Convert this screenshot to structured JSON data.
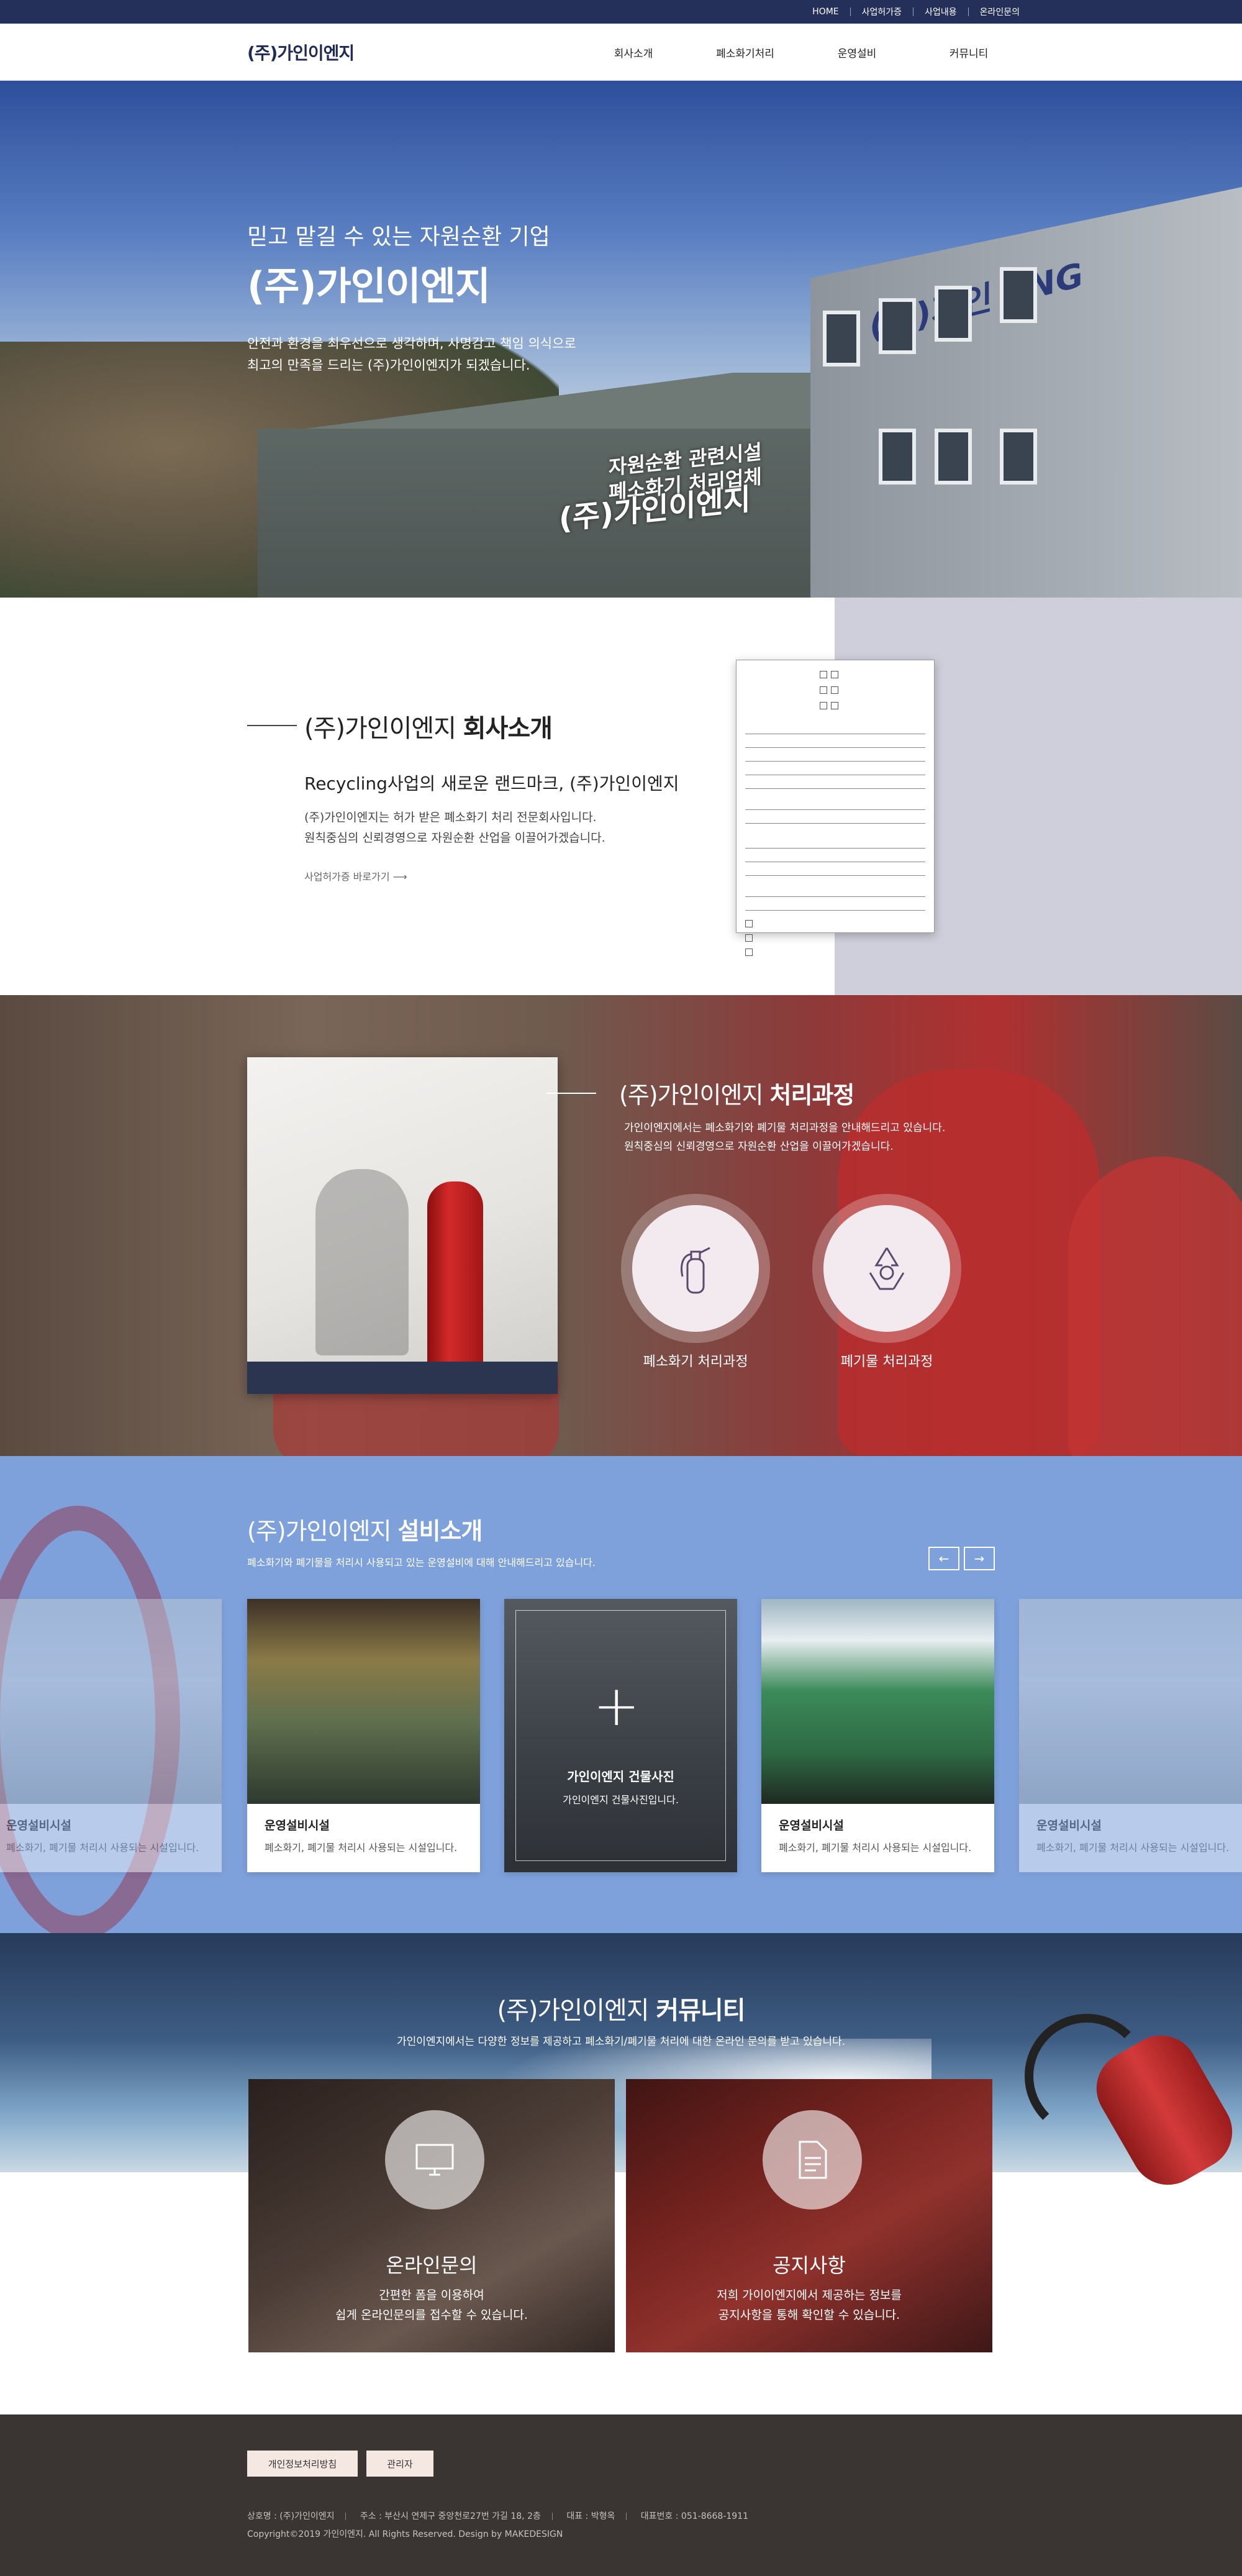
{
  "util_nav": [
    "HOME",
    "사업허가증",
    "사업내용",
    "온라인문의"
  ],
  "logo": "(주)가인이엔지",
  "gnb": [
    "회사소개",
    "폐소화기처리",
    "운영설비",
    "커뮤니티"
  ],
  "hero": {
    "subtitle": "믿고 맡길 수 있는 자원순환 기업",
    "title": "(주)가인이엔지",
    "desc_line1": "안전과 환경을 최우선으로 생각하며, 사명감고 책임 의식으로",
    "desc_line2": "최고의 만족을 드리는 (주)가인이엔지가 되겠습니다.",
    "building_sign_main": "(주)가인이엔지",
    "building_sign_top1": "자원순환 관련시설",
    "building_sign_top2": "폐소화기 처리업체",
    "building_sign_eng": "(주)가인 ENG"
  },
  "about": {
    "title_light": "(주)가인이엔지",
    "title_bold": "회사소개",
    "lead": "Recycling사업의 새로운 랜드마크, (주)가인이엔지",
    "desc_line1": "(주)가인이엔지는 허가 받은 폐소화기 처리 전문회사입니다.",
    "desc_line2": "원칙중심의 신뢰경영으로 자원순환 산업을 이끌어가겠습니다.",
    "more": "사업허가증 바로가기"
  },
  "process": {
    "title_light": "(주)가인이엔지",
    "title_bold": "처리과정",
    "desc_line1": "가인이엔지에서는 폐소화기와 폐기물 처리과정을 안내해드리고 있습니다.",
    "desc_line2": "원칙중심의 신뢰경영으로 자원순환 산업을 이끌어가겠습니다.",
    "items": [
      {
        "label": "폐소화기 처리과정",
        "icon": "fire-extinguisher-icon"
      },
      {
        "label": "폐기물 처리과정",
        "icon": "recycle-icon"
      }
    ]
  },
  "equipment": {
    "title_light": "(주)가인이엔지",
    "title_bold": "설비소개",
    "desc": "폐소화기와 폐기물을 처리시 사용되고 있는 운영설비에 대해 안내해드리고 있습니다.",
    "prev": "←",
    "next": "→",
    "cards": [
      {
        "title": "운영설비시설",
        "desc": "폐소화기, 폐기물 처리시 사용되는 시설입니다."
      },
      {
        "title": "운영설비시설",
        "desc": "폐소화기, 폐기물 처리시 사용되는 시설입니다."
      },
      {
        "title": "가인이엔지 건물사진",
        "desc": "가인이엔지 건물사진입니다."
      },
      {
        "title": "운영설비시설",
        "desc": "폐소화기, 폐기물 처리시 사용되는 시설입니다."
      },
      {
        "title": "운영설비시설",
        "desc": "폐소화기, 폐기물 처리시 사용되는 시설입니다."
      }
    ]
  },
  "community": {
    "title_light": "(주)가인이엔지",
    "title_bold": "커뮤니티",
    "desc": "가인이엔지에서는 다양한 정보를 제공하고 폐소화기/폐기물 처리에 대한 온라인 문의를 받고 있습니다.",
    "boxes": [
      {
        "title": "온라인문의",
        "line1": "간편한 폼을 이용하여",
        "line2": "쉽게 온라인문의를 접수할 수 있습니다.",
        "icon": "monitor-icon"
      },
      {
        "title": "공지사항",
        "line1": "저희 가이이엔지에서 제공하는 정보를",
        "line2": "공지사항을 통해 확인할 수 있습니다.",
        "icon": "document-icon"
      }
    ]
  },
  "footer": {
    "btn_privacy": "개인정보처리방침",
    "btn_admin": "관리자",
    "company": "상호명 : (주)가인이엔지",
    "address": "주소 : 부산시 연제구 중앙천로27번 가길 18, 2층",
    "ceo": "대표 : 박형옥",
    "phone": "대표번호 : 051-8668-1911",
    "copyright": "Copyright©2019 가인이엔지. All Rights Reserved. Design by MAKEDESIGN"
  }
}
